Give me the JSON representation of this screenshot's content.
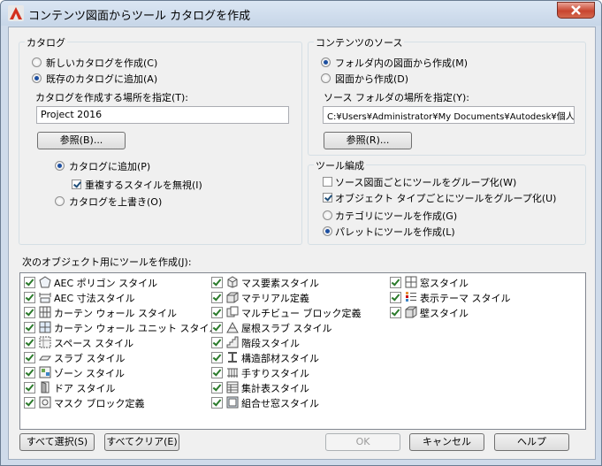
{
  "window": {
    "title": "コンテンツ図面からツール カタログを作成"
  },
  "catalog": {
    "group_title": "カタログ",
    "new_catalog": "新しいカタログを作成(C)",
    "existing_catalog": "既存のカタログに追加(A)",
    "location_label": "カタログを作成する場所を指定(T):",
    "location_value": "Project 2016",
    "browse_label": "参照(B)...",
    "add_to_catalog": "カタログに追加(P)",
    "ignore_duplicate": "重複するスタイルを無視(I)",
    "overwrite_catalog": "カタログを上書き(O)"
  },
  "source": {
    "group_title": "コンテンツのソース",
    "from_folder": "フォルダ内の図面から作成(M)",
    "from_drawing": "図面から作成(D)",
    "folder_label": "ソース フォルダの場所を指定(Y):",
    "folder_value": "C:¥Users¥Administrator¥My Documents¥Autodesk¥個人",
    "browse_label": "参照(R)..."
  },
  "tool_org": {
    "group_title": "ツール編成",
    "group_by_source": "ソース図面ごとにツールをグループ化(W)",
    "group_by_object": "オブジェクト タイプごとにツールをグループ化(U)",
    "create_category": "カテゴリにツールを作成(G)",
    "create_palette": "パレットにツールを作成(L)"
  },
  "objects": {
    "label": "次のオブジェクト用にツールを作成(J):",
    "items": [
      {
        "label": "AEC ポリゴン スタイル",
        "icon": "polygon-icon"
      },
      {
        "label": "AEC 寸法スタイル",
        "icon": "dimension-icon"
      },
      {
        "label": "カーテン ウォール スタイル",
        "icon": "curtain-wall-icon"
      },
      {
        "label": "カーテン ウォール ユニット スタイル",
        "icon": "curtain-wall-unit-icon"
      },
      {
        "label": "スペース スタイル",
        "icon": "space-icon"
      },
      {
        "label": "スラブ スタイル",
        "icon": "slab-icon"
      },
      {
        "label": "ゾーン スタイル",
        "icon": "zone-icon"
      },
      {
        "label": "ドア スタイル",
        "icon": "door-icon"
      },
      {
        "label": "マスク ブロック定義",
        "icon": "mask-block-icon"
      },
      {
        "label": "マス要素スタイル",
        "icon": "mass-element-icon"
      },
      {
        "label": "マテリアル定義",
        "icon": "material-icon"
      },
      {
        "label": "マルチビュー ブロック定義",
        "icon": "multiview-block-icon"
      },
      {
        "label": "屋根スラブ スタイル",
        "icon": "roof-slab-icon"
      },
      {
        "label": "階段スタイル",
        "icon": "stair-icon"
      },
      {
        "label": "構造部材スタイル",
        "icon": "structural-member-icon"
      },
      {
        "label": "手すりスタイル",
        "icon": "railing-icon"
      },
      {
        "label": "集計表スタイル",
        "icon": "schedule-table-icon"
      },
      {
        "label": "組合せ窓スタイル",
        "icon": "window-assembly-icon"
      },
      {
        "label": "窓スタイル",
        "icon": "window-icon"
      },
      {
        "label": "表示テーマ スタイル",
        "icon": "display-theme-icon"
      },
      {
        "label": "壁スタイル",
        "icon": "wall-icon"
      }
    ]
  },
  "buttons": {
    "select_all": "すべて選択(S)",
    "clear_all": "すべてクリア(E)",
    "ok": "OK",
    "cancel": "キャンセル",
    "help": "ヘルプ"
  },
  "colors": {
    "accent": "#1d4fa0",
    "check": "#2a7a2a",
    "titlebar": "#cfdbea",
    "close": "#c8452f"
  }
}
